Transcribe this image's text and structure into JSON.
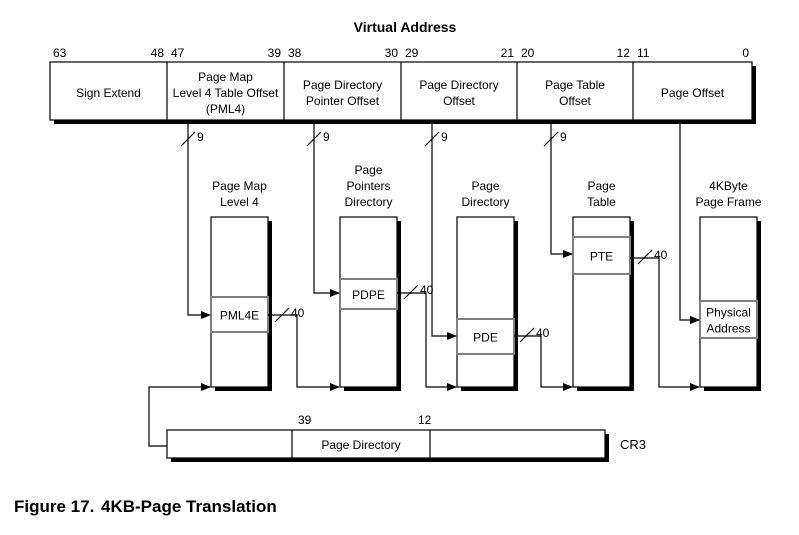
{
  "title": "Virtual Address",
  "virtual_address": {
    "fields": [
      {
        "label": [
          "Sign Extend"
        ],
        "hi": "63",
        "lo": "48"
      },
      {
        "label": [
          "Page Map",
          "Level 4 Table Offset",
          "(PML4)"
        ],
        "hi": "47",
        "lo": "39"
      },
      {
        "label": [
          "Page Directory",
          "Pointer Offset"
        ],
        "hi": "38",
        "lo": "30"
      },
      {
        "label": [
          "Page Directory",
          "Offset"
        ],
        "hi": "29",
        "lo": "21"
      },
      {
        "label": [
          "Page Table",
          "Offset"
        ],
        "hi": "20",
        "lo": "12"
      },
      {
        "label": [
          "Page Offset"
        ],
        "hi": "11",
        "lo": "0"
      }
    ]
  },
  "index_bus_width": "9",
  "entry_bus_width": "40",
  "tables": [
    {
      "title": [
        "Page Map",
        "Level 4"
      ],
      "entry": [
        "PML4E"
      ]
    },
    {
      "title": [
        "Page",
        "Pointers",
        "Directory"
      ],
      "entry": [
        "PDPE"
      ]
    },
    {
      "title": [
        "Page",
        "Directory"
      ],
      "entry": [
        "PDE"
      ]
    },
    {
      "title": [
        "Page",
        "Table"
      ],
      "entry": [
        "PTE"
      ]
    },
    {
      "title": [
        "4KByte",
        "Page Frame"
      ],
      "entry": [
        "Physical",
        "Address"
      ]
    }
  ],
  "cr3": {
    "name": "CR3",
    "field_label": "Page Directory",
    "hi": "39",
    "lo": "12"
  },
  "caption": {
    "number": "Figure 17.",
    "text": "4KB-Page Translation"
  }
}
